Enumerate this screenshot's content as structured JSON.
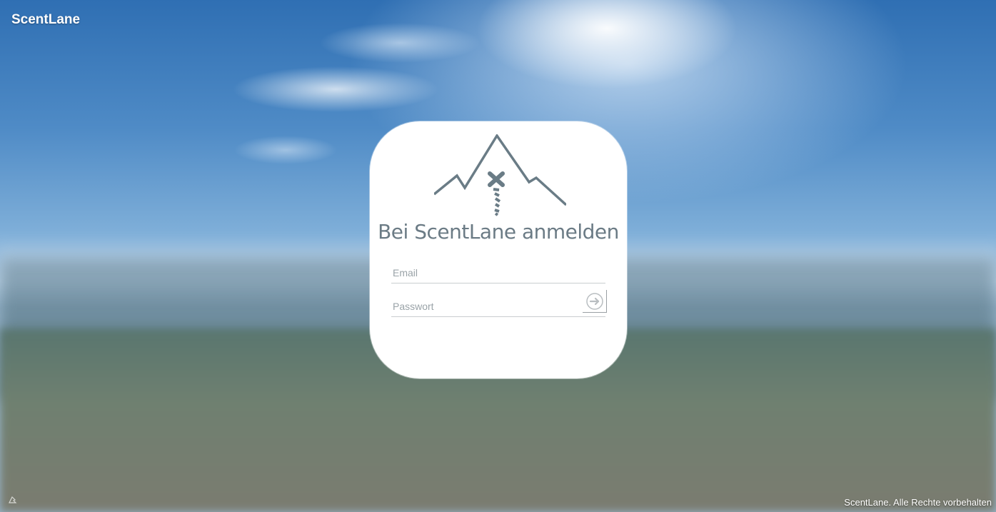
{
  "app": {
    "title": "ScentLane"
  },
  "login": {
    "heading": "Bei ScentLane anmelden",
    "email_placeholder": "Email",
    "password_placeholder": "Passwort",
    "submit_icon": "arrow-right-circle-icon"
  },
  "footer": {
    "copyright": "ScentLane. Alle Rechte vorbehalten"
  },
  "colors": {
    "logo": "#6a7c86",
    "heading": "#6b7b85",
    "card": "#ffffff"
  }
}
